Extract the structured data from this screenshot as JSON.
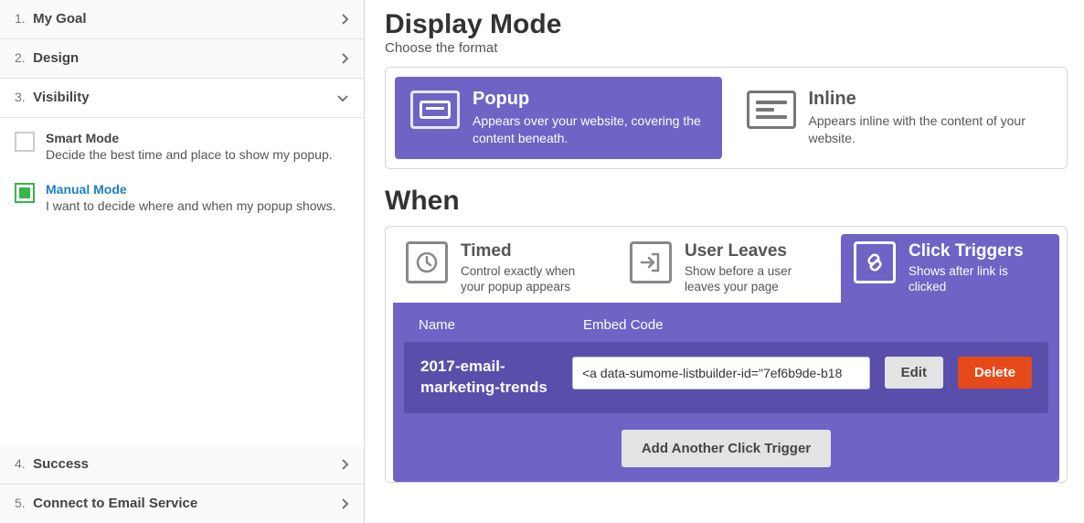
{
  "sidebar": {
    "steps": [
      {
        "num": "1.",
        "label": "My Goal"
      },
      {
        "num": "2.",
        "label": "Design"
      },
      {
        "num": "3.",
        "label": "Visibility"
      },
      {
        "num": "4.",
        "label": "Success"
      },
      {
        "num": "5.",
        "label": "Connect to Email Service"
      }
    ],
    "smart_mode": {
      "title": "Smart Mode",
      "desc": "Decide the best time and place to show my popup."
    },
    "manual_mode": {
      "title": "Manual Mode",
      "desc": "I want to decide where and when my popup shows."
    }
  },
  "display_mode": {
    "heading": "Display Mode",
    "subheading": "Choose the format",
    "popup": {
      "title": "Popup",
      "desc": "Appears over your website, covering the content beneath."
    },
    "inline": {
      "title": "Inline",
      "desc": "Appears inline with the content of your website."
    }
  },
  "when": {
    "heading": "When",
    "timed": {
      "title": "Timed",
      "desc": "Control exactly when your popup appears"
    },
    "leaves": {
      "title": "User Leaves",
      "desc": "Show before a user leaves your page"
    },
    "click": {
      "title": "Click Triggers",
      "desc": "Shows after link is clicked"
    }
  },
  "click_triggers": {
    "col_name": "Name",
    "col_embed": "Embed Code",
    "row_name": "2017-email-marketing-trends",
    "row_code": "<a data-sumome-listbuilder-id=\"7ef6b9de-b18",
    "edit": "Edit",
    "delete": "Delete",
    "add": "Add Another Click Trigger"
  }
}
